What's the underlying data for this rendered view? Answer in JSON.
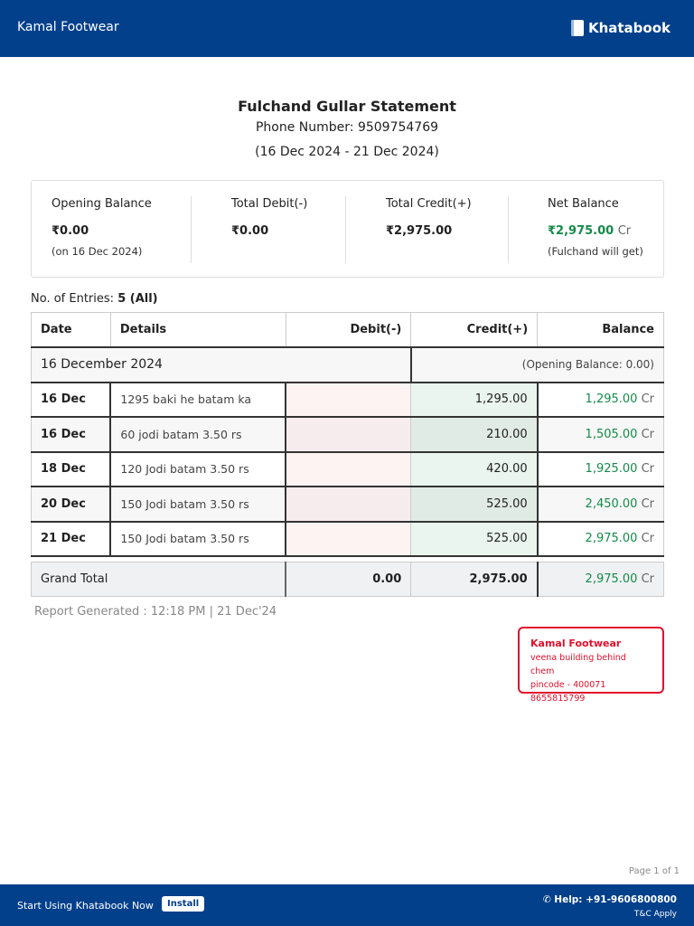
{
  "header": {
    "shop": "Kamal Footwear",
    "brand": "Khatabook"
  },
  "statement": {
    "title": "Fulchand Gullar Statement",
    "phone": "Phone Number: 9509754769",
    "range": "(16 Dec 2024 - 21 Dec 2024)"
  },
  "summary": {
    "opening": {
      "label": "Opening Balance",
      "value": "₹0.00",
      "sub": "(on 16 Dec 2024)"
    },
    "debit": {
      "label": "Total Debit(-)",
      "value": "₹0.00"
    },
    "credit": {
      "label": "Total Credit(+)",
      "value": "₹2,975.00"
    },
    "net": {
      "label": "Net Balance",
      "value": "₹2,975.00",
      "suffix": "Cr",
      "sub": "(Fulchand will get)"
    }
  },
  "entries": {
    "label": "No. of Entries:",
    "value": "5 (All)"
  },
  "table": {
    "headers": [
      "Date",
      "Details",
      "Debit(-)",
      "Credit(+)",
      "Balance"
    ],
    "group": {
      "label": "16 December 2024",
      "opening": "(Opening Balance: 0.00)"
    },
    "rows": [
      {
        "date": "16 Dec",
        "details": "1295 baki he batam ka",
        "debit": "",
        "credit": "1,295.00",
        "balance": "1,295.00",
        "cr": "Cr"
      },
      {
        "date": "16 Dec",
        "details": "60 jodi batam 3.50 rs",
        "debit": "",
        "credit": "210.00",
        "balance": "1,505.00",
        "cr": "Cr"
      },
      {
        "date": "18 Dec",
        "details": "120 Jodi batam 3.50 rs",
        "debit": "",
        "credit": "420.00",
        "balance": "1,925.00",
        "cr": "Cr"
      },
      {
        "date": "20 Dec",
        "details": "150 Jodi batam 3.50 rs",
        "debit": "",
        "credit": "525.00",
        "balance": "2,450.00",
        "cr": "Cr"
      },
      {
        "date": "21 Dec",
        "details": "150 Jodi batam 3.50 rs",
        "debit": "",
        "credit": "525.00",
        "balance": "2,975.00",
        "cr": "Cr"
      }
    ],
    "total": {
      "label": "Grand Total",
      "debit": "0.00",
      "credit": "2,975.00",
      "balance": "2,975.00",
      "cr": "Cr"
    }
  },
  "report": "Report Generated : 12:18 PM | 21 Dec'24",
  "stamp": {
    "name": "Kamal Footwear",
    "line1": "veena building behind chem",
    "line2": "pincode - 400071",
    "line3": "8655815799"
  },
  "page": "Page 1 of 1",
  "footer": {
    "cta": "Start Using Khatabook Now",
    "install": "Install",
    "help": "Help: +91-9606800800",
    "tc": "T&C Apply"
  }
}
